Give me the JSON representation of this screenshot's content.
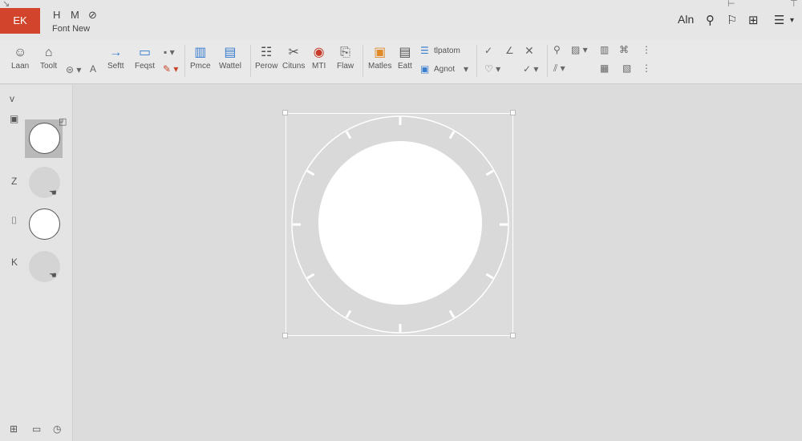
{
  "app": {
    "badge": "ΕΚ",
    "top_icons": [
      "H",
      "M",
      "⊘"
    ],
    "file_name": "Font New",
    "search_label": "Aln"
  },
  "ribbon": {
    "tools": [
      {
        "label": "Laan",
        "icon": "user-icon"
      },
      {
        "label": "Toolt",
        "icon": "home-lock-icon"
      },
      {
        "label": "Seftt",
        "icon": "arrow-right-icon"
      },
      {
        "label": "Feqst",
        "icon": "folder-icon"
      },
      {
        "label": "Pmce",
        "icon": "bar-chart-icon"
      },
      {
        "label": "Wattel",
        "icon": "document-chart-icon"
      },
      {
        "label": "Perow",
        "icon": "list-icon"
      },
      {
        "label": "Cituns",
        "icon": "scissors-icon"
      },
      {
        "label": "MTI",
        "icon": "color-wheel-icon"
      },
      {
        "label": "Flaw",
        "icon": "page-edit-icon"
      },
      {
        "label": "Matles",
        "icon": "orange-page-icon"
      },
      {
        "label": "Eatt",
        "icon": "text-page-icon"
      }
    ],
    "text_items": {
      "top": "tlpatom",
      "bottom": "Agnot"
    },
    "accent_orange": "#e08a2a",
    "accent_blue": "#3a7ed0",
    "brand_red": "#d2452c"
  },
  "sidepanel": {
    "marks": [
      "v",
      "Z",
      "⌷",
      "K"
    ]
  },
  "canvas": {
    "background": "#dcdcdc",
    "ring_color": "#ffffff"
  }
}
